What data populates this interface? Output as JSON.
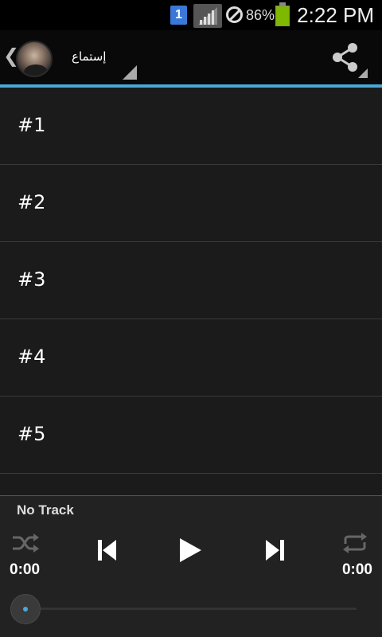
{
  "status_bar": {
    "notification_badge": "1",
    "battery_percent": "86%",
    "time": "2:22 PM",
    "icons": [
      "notification-icon",
      "signal-icon",
      "do-not-disturb-icon",
      "battery-icon"
    ]
  },
  "action_bar": {
    "title": "إستماع",
    "icons": [
      "back-chevron-icon",
      "avatar",
      "share-icon"
    ],
    "accent_color": "#4aa8d8"
  },
  "tracks": [
    {
      "label": "#1"
    },
    {
      "label": "#2"
    },
    {
      "label": "#3"
    },
    {
      "label": "#4"
    },
    {
      "label": "#5"
    }
  ],
  "player": {
    "now_playing": "No Track",
    "elapsed": "0:00",
    "duration": "0:00",
    "progress": 0,
    "icons": [
      "shuffle-icon",
      "previous-icon",
      "play-icon",
      "next-icon",
      "repeat-icon"
    ]
  }
}
